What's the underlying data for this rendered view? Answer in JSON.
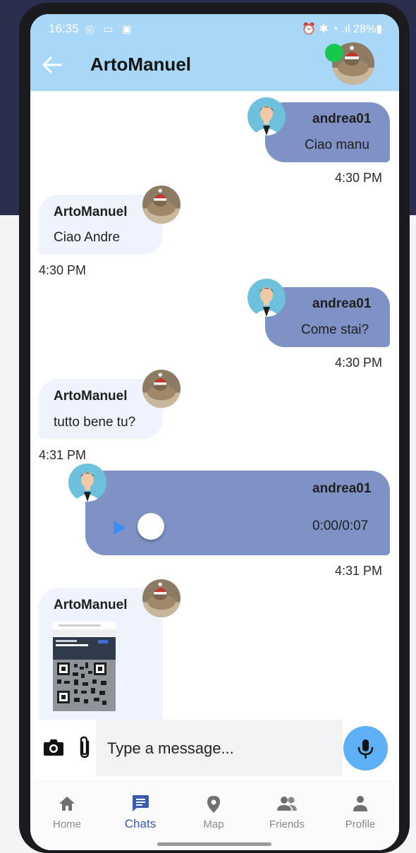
{
  "status_bar": {
    "time": "16:35",
    "left_icons": "◎ ▭ ▣",
    "right": "⏰ ✱ ◔ .ıl 28%▮"
  },
  "header": {
    "title": "ArtoManuel",
    "back_icon": "arrow-left-icon",
    "online_color": "#16c94a"
  },
  "messages": [
    {
      "direction": "out",
      "sender": "andrea01",
      "text": "Ciao manu",
      "time": "4:30 PM"
    },
    {
      "direction": "in",
      "sender": "ArtoManuel",
      "text": "Ciao Andre",
      "time": "4:30 PM"
    },
    {
      "direction": "out",
      "sender": "andrea01",
      "text": "Come stai?",
      "time": "4:30 PM"
    },
    {
      "direction": "in",
      "sender": "ArtoManuel",
      "text": "tutto bene tu?",
      "time": "4:31 PM"
    },
    {
      "direction": "out",
      "sender": "andrea01",
      "type": "audio",
      "duration": "0:00/0:07",
      "progress": 0,
      "time": "4:31 PM"
    },
    {
      "direction": "in",
      "sender": "ArtoManuel",
      "type": "image",
      "image_icon": "qr-code-screenshot"
    }
  ],
  "composer": {
    "placeholder": "Type a message...",
    "camera_icon": "camera-icon",
    "attach_icon": "paperclip-icon",
    "mic_icon": "mic-icon"
  },
  "nav": {
    "items": [
      {
        "label": "Home",
        "icon": "home-icon"
      },
      {
        "label": "Chats",
        "icon": "chat-icon",
        "active": true
      },
      {
        "label": "Map",
        "icon": "location-pin-icon"
      },
      {
        "label": "Friends",
        "icon": "people-icon"
      },
      {
        "label": "Profile",
        "icon": "person-icon"
      }
    ]
  },
  "colors": {
    "header_bg": "#a8d7f7",
    "outgoing_bubble": "#7f92c6",
    "incoming_bubble": "#eef3fd",
    "accent": "#3a5bb0",
    "mic_button": "#5db0f5"
  }
}
